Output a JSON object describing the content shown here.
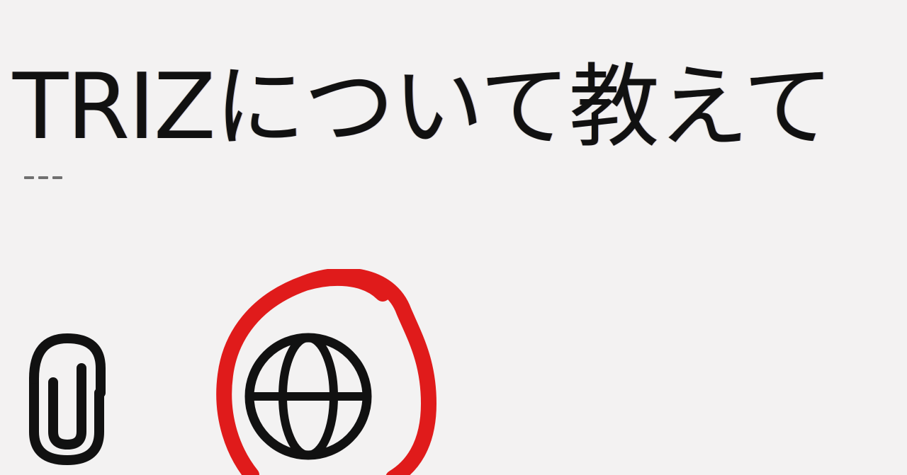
{
  "prompt": {
    "text": "TRIZについて教えて"
  },
  "toolbar": {
    "attach_icon": "paperclip-icon",
    "web_search_icon": "globe-icon"
  },
  "annotation": {
    "shape": "hand-drawn-circle",
    "color": "#e01b1b",
    "target": "globe-icon"
  }
}
